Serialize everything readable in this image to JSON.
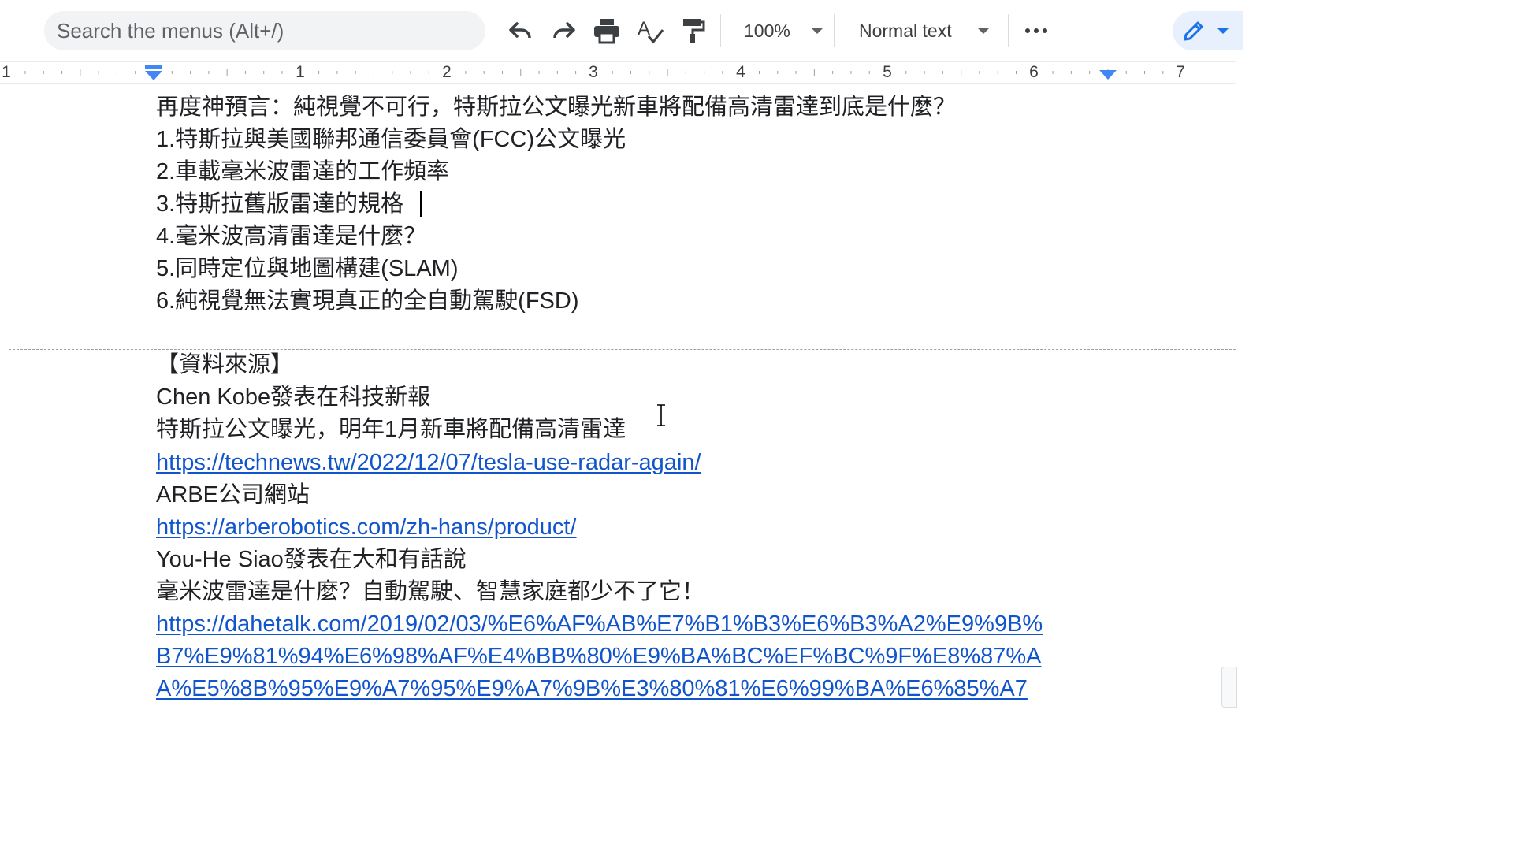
{
  "toolbar": {
    "search_placeholder": "Search the menus (Alt+/)",
    "zoom": "100%",
    "style": "Normal text",
    "icons": [
      "undo-icon",
      "redo-icon",
      "print-icon",
      "spellcheck-icon",
      "paint-format-icon",
      "more-icon",
      "pencil-icon"
    ]
  },
  "ruler": {
    "labels": [
      "1",
      "1",
      "2",
      "3",
      "4",
      "5",
      "6",
      "7"
    ]
  },
  "document": {
    "page1_lines": [
      "再度神預言：純視覺不可行，特斯拉公文曝光新車將配備高清雷達到底是什麼？",
      "1.特斯拉與美國聯邦通信委員會(FCC)公文曝光",
      "2.車載毫米波雷達的工作頻率",
      "3.特斯拉舊版雷達的規格",
      "4.毫米波高清雷達是什麼？",
      "5.同時定位與地圖構建(SLAM)",
      "6.純視覺無法實現真正的全自動駕駛(FSD)"
    ],
    "sources_heading": "【資料來源】",
    "source1_author": "Chen Kobe發表在科技新報",
    "source1_title": "特斯拉公文曝光，明年1月新車將配備高清雷達",
    "source1_url": "https://technews.tw/2022/12/07/tesla-use-radar-again/",
    "source2_title": "ARBE公司網站",
    "source2_url": "https://arberobotics.com/zh-hans/product/",
    "source3_author": "You-He Siao發表在大和有話說",
    "source3_title": "毫米波雷達是什麼？自動駕駛、智慧家庭都少不了它！",
    "source3_url_line1": "https://dahetalk.com/2019/02/03/%E6%AF%AB%E7%B1%B3%E6%B3%A2%E9%9B%",
    "source3_url_line2": "B7%E9%81%94%E6%98%AF%E4%BB%80%E9%BA%BC%EF%BC%9F%E8%87%A",
    "source3_url_line3": "A%E5%8B%95%E9%A7%95%E9%A7%9B%E3%80%81%E6%99%BA%E6%85%A7"
  },
  "colors": {
    "link": "#1155cc",
    "text": "#202124",
    "accent": "#4285f4"
  }
}
